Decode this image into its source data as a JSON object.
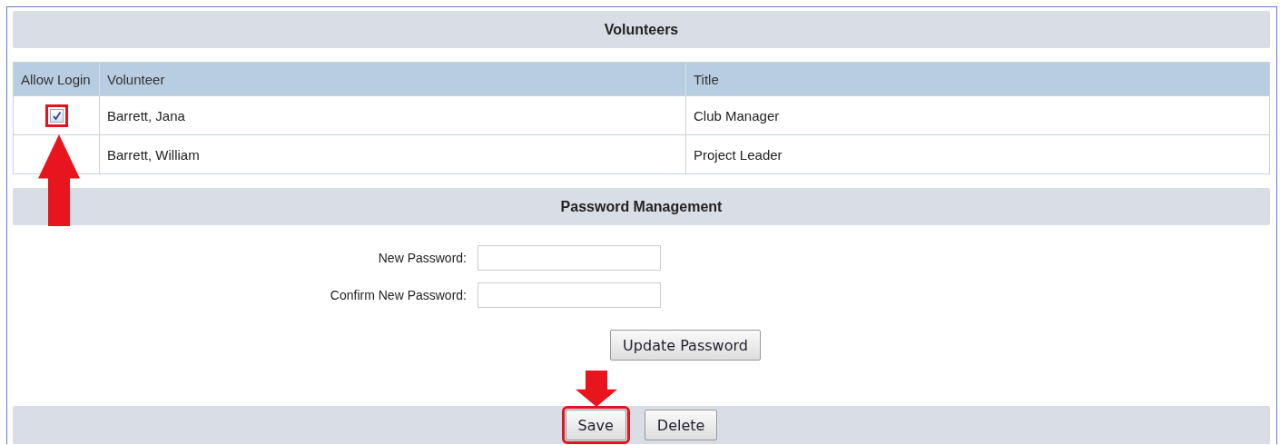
{
  "volunteers": {
    "title": "Volunteers",
    "columns": [
      "Allow Login",
      "Volunteer",
      "Title"
    ],
    "rows": [
      {
        "allow_login": {
          "checked": true,
          "highlighted": true
        },
        "volunteer": "Barrett, Jana",
        "title": "Club Manager"
      },
      {
        "volunteer": "Barrett, William",
        "title": "Project Leader"
      }
    ]
  },
  "password_management": {
    "title": "Password Management",
    "fields": [
      {
        "label": "New Password:"
      },
      {
        "label": "Confirm New Password:"
      }
    ],
    "button": "Update Password"
  },
  "footer_buttons": [
    {
      "label": "Save",
      "highlighted": true
    },
    {
      "label": "Delete",
      "highlighted": false
    }
  ]
}
